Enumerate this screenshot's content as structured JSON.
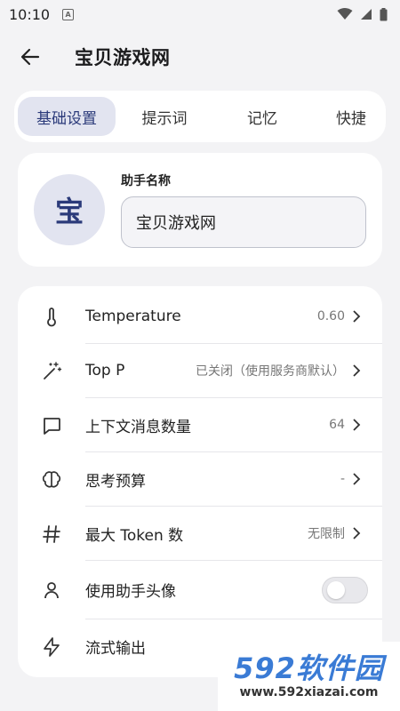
{
  "status_bar": {
    "time": "10:10",
    "badge": "A",
    "icons": [
      "wifi-icon",
      "signal-icon",
      "battery-icon"
    ]
  },
  "app_bar": {
    "title": "宝贝游戏网",
    "back_icon": "arrow-left-icon"
  },
  "tabs": [
    {
      "label": "基础设置",
      "active": true
    },
    {
      "label": "提示词",
      "active": false
    },
    {
      "label": "记忆",
      "active": false
    },
    {
      "label": "快捷",
      "active": false
    }
  ],
  "identity": {
    "avatar_text": "宝",
    "name_label": "助手名称",
    "name_value": "宝贝游戏网"
  },
  "settings": [
    {
      "icon": "thermometer-icon",
      "label": "Temperature",
      "value": "0.60"
    },
    {
      "icon": "magic-wand-icon",
      "label": "Top P",
      "value": "已关闭（使用服务商默认）"
    },
    {
      "icon": "message-bubble-icon",
      "label": "上下文消息数量",
      "value": "64"
    },
    {
      "icon": "brain-icon",
      "label": "思考预算",
      "value": "-"
    },
    {
      "icon": "hash-icon",
      "label": "最大 Token 数",
      "value": "无限制"
    },
    {
      "icon": "user-icon",
      "label": "使用助手头像",
      "toggle": false
    },
    {
      "icon": "lightning-icon",
      "label": "流式输出"
    }
  ],
  "watermark": {
    "big": "592软件园",
    "small": "www.592xiazai.com"
  },
  "colors": {
    "accent": "#2b3a7a",
    "accent_bg": "#e2e4f0",
    "page_bg": "#f3f3f5"
  }
}
